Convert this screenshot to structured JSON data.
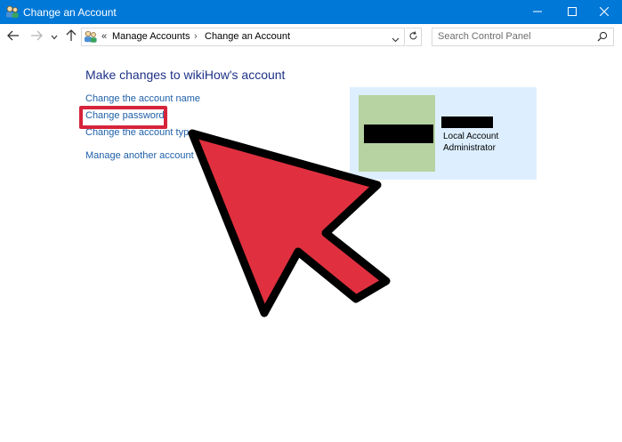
{
  "window": {
    "title": "Change an Account",
    "controls": {
      "minimize": "minimize-icon",
      "maximize": "maximize-icon",
      "close": "close-icon"
    }
  },
  "navigation": {
    "back": "arrow-left-icon",
    "forward": "arrow-right-icon",
    "recent": "chevron-down-icon",
    "up": "arrow-up-icon",
    "address": {
      "overflow": "«",
      "crumbs": [
        "Manage Accounts",
        "Change an Account"
      ],
      "separator": "›"
    },
    "refresh": "refresh-icon",
    "search": {
      "placeholder": "Search Control Panel",
      "icon": "search-icon"
    }
  },
  "main": {
    "heading": "Make changes to wikiHow's account",
    "links": [
      "Change the account name",
      "Change  password",
      "Change the account type",
      "Manage another account"
    ]
  },
  "account": {
    "type": "Local Account",
    "role": "Administrator"
  },
  "colors": {
    "titlebar": "#0078d7",
    "link": "#1e5fa8",
    "heading": "#1e3287",
    "highlight": "#d6243a",
    "arrow": "#e0303f",
    "card": "#ddefff",
    "avatar": "#b6d3a1"
  }
}
